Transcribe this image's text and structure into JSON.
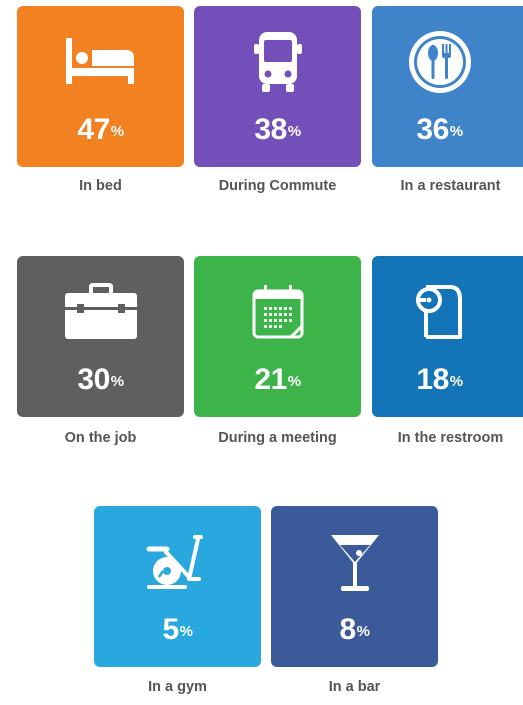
{
  "tiles": [
    {
      "id": "in-bed",
      "value": "47",
      "unit": "%",
      "label": "In bed",
      "color": "#f28121",
      "icon": "bed-icon"
    },
    {
      "id": "during-commute",
      "value": "38",
      "unit": "%",
      "label": "During Commute",
      "color": "#7350b9",
      "icon": "bus-icon"
    },
    {
      "id": "in-a-restaurant",
      "value": "36",
      "unit": "%",
      "label": "In a restaurant",
      "color": "#3f84c9",
      "icon": "restaurant-icon"
    },
    {
      "id": "on-the-job",
      "value": "30",
      "unit": "%",
      "label": "On the job",
      "color": "#5f5f5f",
      "icon": "briefcase-icon"
    },
    {
      "id": "during-a-meeting",
      "value": "21",
      "unit": "%",
      "label": "During a meeting",
      "color": "#3cb44a",
      "icon": "calendar-icon"
    },
    {
      "id": "in-the-restroom",
      "value": "18",
      "unit": "%",
      "label": "In the restroom",
      "color": "#1474b8",
      "icon": "toilet-paper-icon"
    },
    {
      "id": "in-a-gym",
      "value": "5",
      "unit": "%",
      "label": "In a gym",
      "color": "#29a8e0",
      "icon": "exercise-bike-icon"
    },
    {
      "id": "in-a-bar",
      "value": "8",
      "unit": "%",
      "label": "In a bar",
      "color": "#3b5a9a",
      "icon": "cocktail-icon"
    }
  ]
}
